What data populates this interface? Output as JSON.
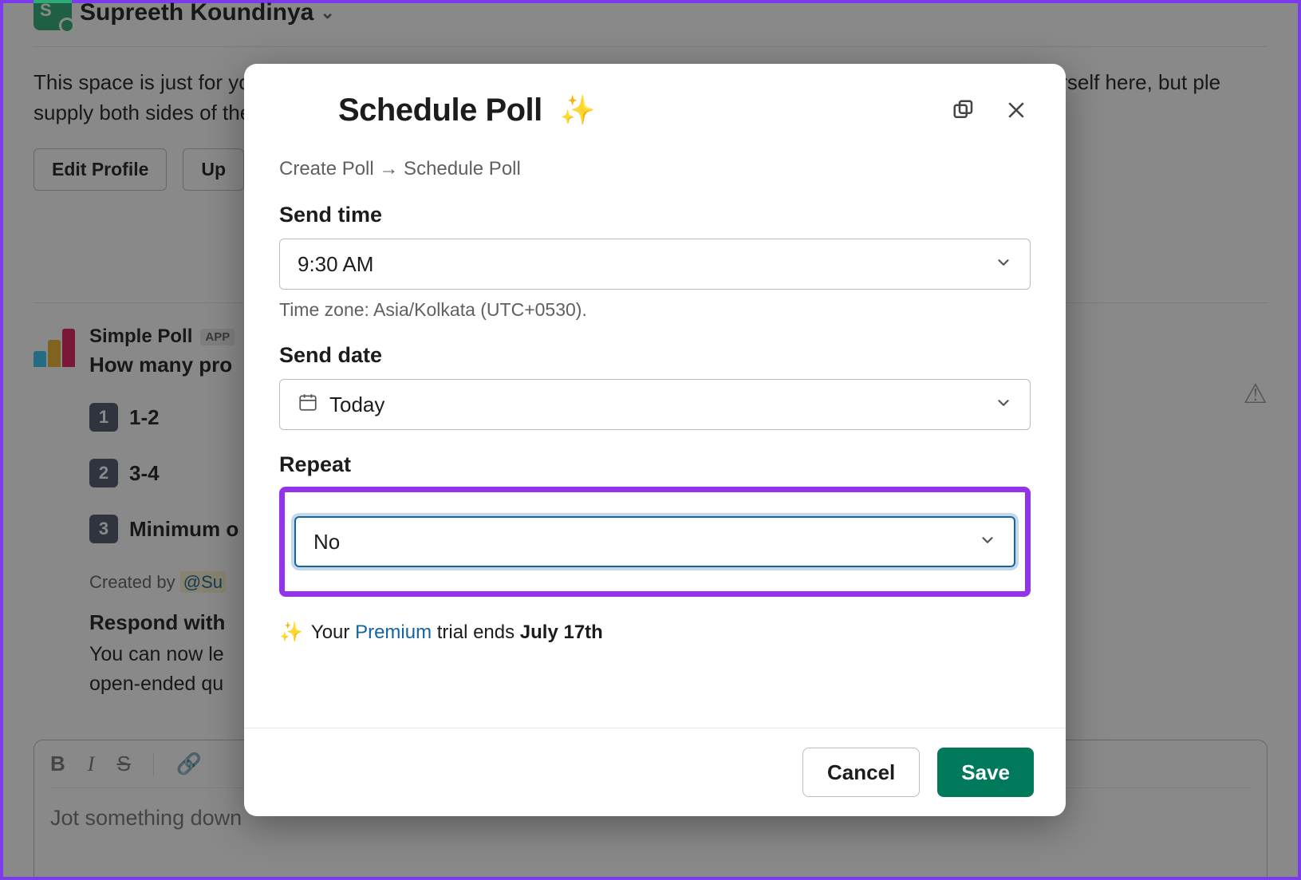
{
  "bg": {
    "user_name": "Supreeth Koundinya",
    "intro_line1": "This space is just for you. Jot down notes, list your to-dos, or keep links and files handy. You can also talk to yourself here, but ple",
    "intro_line2": "supply both sides of the conversation.",
    "edit_profile": "Edit Profile",
    "upload_btn": "Up",
    "app_name": "Simple Poll",
    "app_badge": "APP",
    "question": "How many pro",
    "opt1": "1-2",
    "opt2": "3-4",
    "opt3": "Minimum o",
    "created_prefix": "Created by ",
    "created_mention": "@Su",
    "respond_title": "Respond with",
    "respond_sub1": "You can now le",
    "respond_sub2": "open-ended qu",
    "composer_placeholder": "Jot something down"
  },
  "modal": {
    "title": "Schedule Poll",
    "breadcrumb": "Create Poll → Schedule Poll",
    "send_time_label": "Send time",
    "send_time_value": "9:30 AM",
    "timezone_hint": "Time zone: Asia/Kolkata (UTC+0530).",
    "send_date_label": "Send date",
    "send_date_value": "Today",
    "repeat_label": "Repeat",
    "repeat_value": "No",
    "trial_prefix": "Your ",
    "trial_link": "Premium",
    "trial_mid": " trial ends ",
    "trial_end": "July 17th",
    "cancel": "Cancel",
    "save": "Save"
  }
}
